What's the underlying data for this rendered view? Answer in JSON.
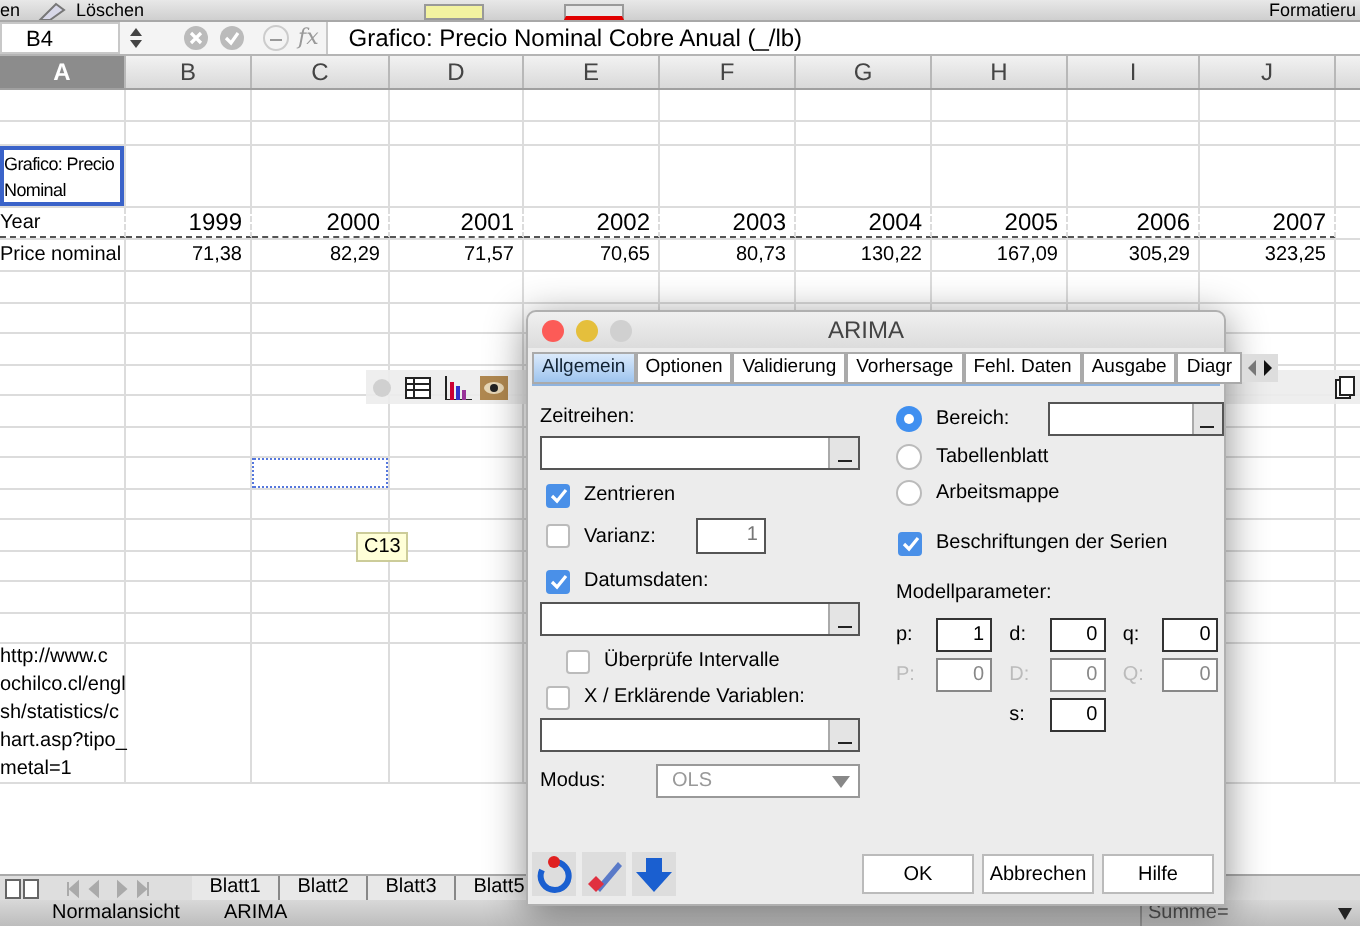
{
  "toolbar": {
    "left_label": "en",
    "clear_label": "Löschen",
    "right_label": "Formatieru"
  },
  "formula_bar": {
    "cell_ref": "B4",
    "fx_label": "fx",
    "formula": "Grafico: Precio Nominal Cobre Anual (_/lb)"
  },
  "columns": [
    {
      "label": "A",
      "selected": true
    },
    {
      "label": "B",
      "selected": false
    },
    {
      "label": "C",
      "selected": false
    },
    {
      "label": "D",
      "selected": false
    },
    {
      "label": "E",
      "selected": false
    },
    {
      "label": "F",
      "selected": false
    },
    {
      "label": "G",
      "selected": false
    },
    {
      "label": "H",
      "selected": false
    },
    {
      "label": "I",
      "selected": false
    },
    {
      "label": "J",
      "selected": false
    }
  ],
  "sheet": {
    "title_cell": {
      "text": "Grafico: Precio Nominal",
      "selected": true
    },
    "year_row": [
      "Year",
      "1999",
      "2000",
      "2001",
      "2002",
      "2003",
      "2004",
      "2005",
      "2006",
      "2007"
    ],
    "price_row": [
      "Price nominal",
      "71,38",
      "82,29",
      "71,57",
      "70,65",
      "80,73",
      "130,22",
      "167,09",
      "305,29",
      "323,25"
    ],
    "source_lines": [
      "http://www.c",
      "ochilco.cl/engl",
      "sh/statistics/c",
      "hart.asp?tipo_",
      "metal=1"
    ],
    "tooltip": "C13"
  },
  "sheet_tabs": [
    {
      "label": "Blatt1",
      "selected": false
    },
    {
      "label": "Blatt2",
      "selected": false
    },
    {
      "label": "Blatt3",
      "selected": false
    },
    {
      "label": "Blatt5",
      "selected": false
    }
  ],
  "status_bar": {
    "view": "Normalansicht",
    "mode": "ARIMA",
    "sum": "Summe="
  },
  "dialog": {
    "title": "ARIMA",
    "tabs": [
      {
        "label": "Allgemein",
        "selected": true
      },
      {
        "label": "Optionen",
        "selected": false
      },
      {
        "label": "Validierung",
        "selected": false
      },
      {
        "label": "Vorhersage",
        "selected": false
      },
      {
        "label": "Fehl. Daten",
        "selected": false
      },
      {
        "label": "Ausgabe",
        "selected": false
      },
      {
        "label": "Diagr",
        "selected": false
      }
    ],
    "series_label": "Zeitreihen:",
    "center": {
      "label": "Zentrieren",
      "checked": true
    },
    "variance": {
      "label": "Varianz:",
      "checked": false,
      "value": "1"
    },
    "dates": {
      "label": "Datumsdaten:",
      "checked": true
    },
    "check_intervals": {
      "label": "Überprüfe Intervalle",
      "checked": false
    },
    "x_vars": {
      "label": "X / Erklärende Variablen:",
      "checked": false
    },
    "mode": {
      "label": "Modus:",
      "value": "OLS"
    },
    "range_options": [
      {
        "label": "Bereich:",
        "selected": true
      },
      {
        "label": "Tabellenblatt",
        "selected": false
      },
      {
        "label": "Arbeitsmappe",
        "selected": false
      }
    ],
    "series_labels": {
      "label": "Beschriftungen der Serien",
      "checked": true
    },
    "params_label": "Modellparameter:",
    "params": [
      {
        "label": "p:",
        "value": "1",
        "disabled": false
      },
      {
        "label": "d:",
        "value": "0",
        "disabled": false
      },
      {
        "label": "q:",
        "value": "0",
        "disabled": false
      },
      {
        "label": "P:",
        "value": "0",
        "disabled": true
      },
      {
        "label": "D:",
        "value": "0",
        "disabled": true
      },
      {
        "label": "Q:",
        "value": "0",
        "disabled": true
      }
    ],
    "seasonal": {
      "label": "s:",
      "value": "0"
    },
    "buttons": [
      "OK",
      "Abbrechen",
      "Hilfe"
    ]
  }
}
